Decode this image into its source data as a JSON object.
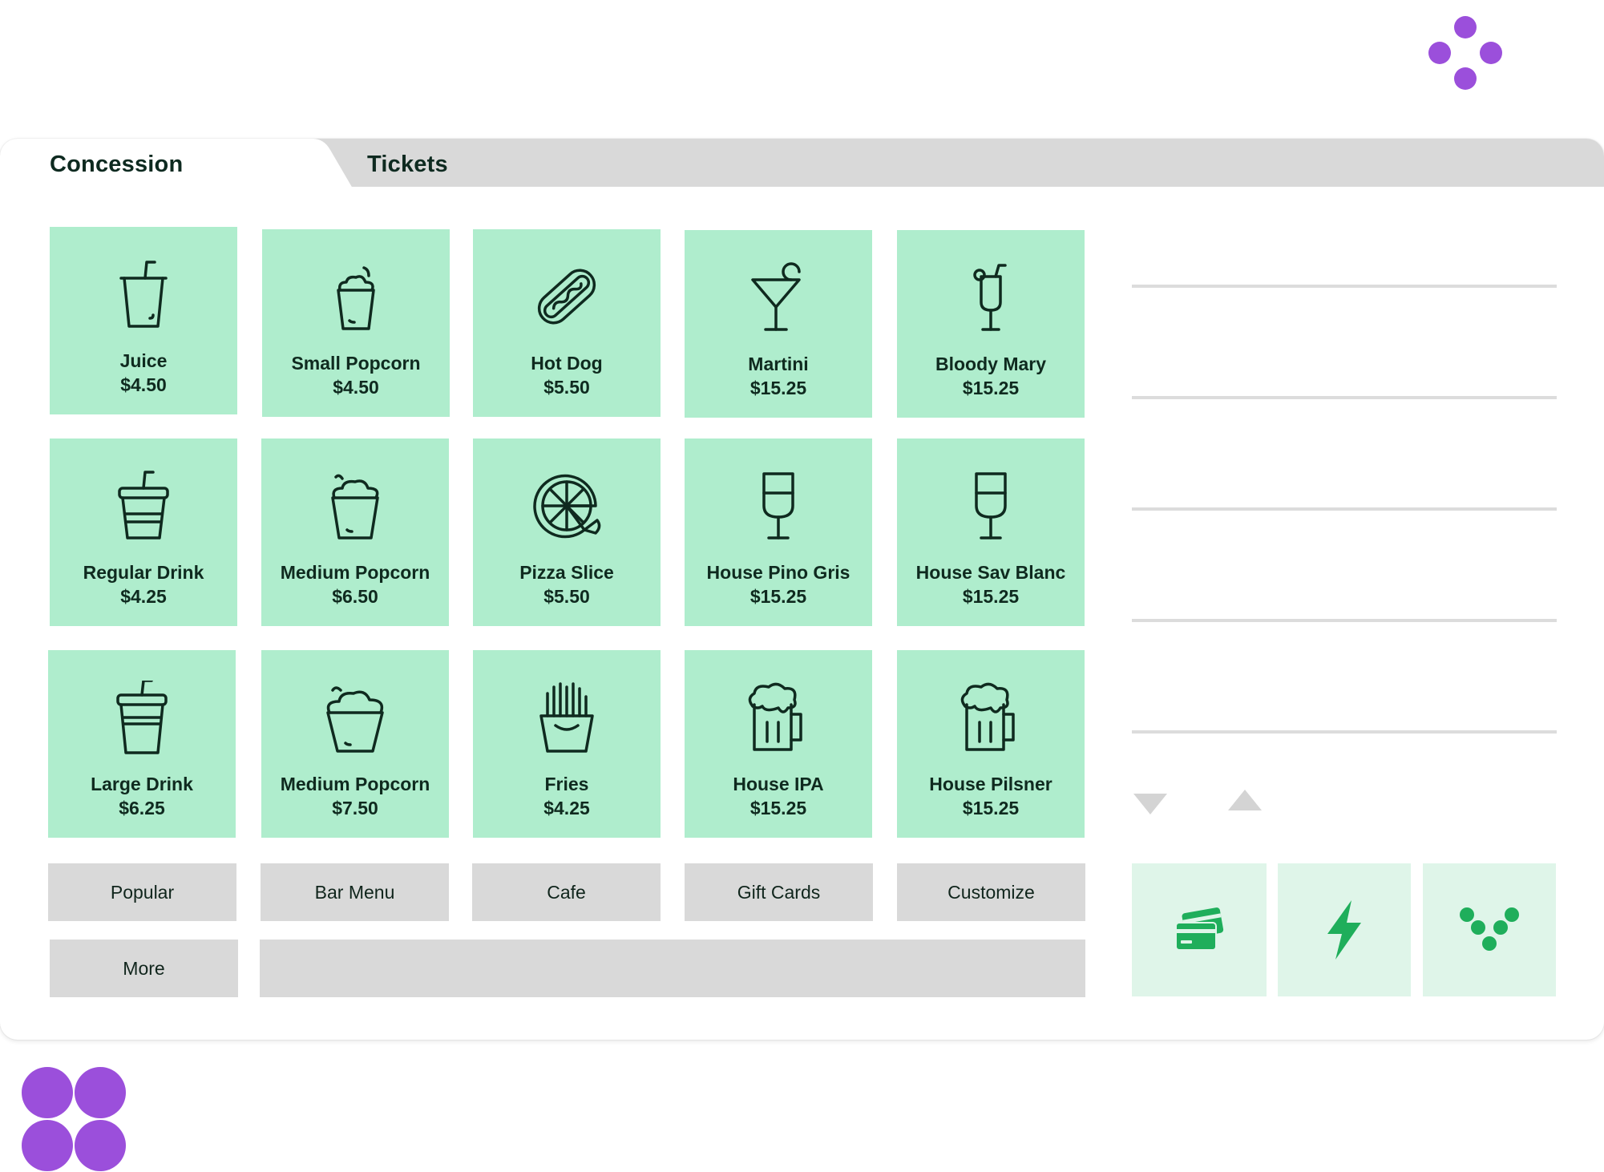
{
  "tabs": {
    "concession": "Concession",
    "tickets": "Tickets"
  },
  "colors": {
    "tile": "#afedcd",
    "category_button": "#d9d9d9",
    "pay_button": "#dff5e9",
    "pay_icon": "#1fae5b",
    "decor_purple": "#9b4fdb",
    "divider": "#dcdcdc",
    "control_icon": "#d4d4d4"
  },
  "items": [
    {
      "name": "Juice",
      "price": "$4.50",
      "icon": "cup-with-straw-icon"
    },
    {
      "name": "Small Popcorn",
      "price": "$4.50",
      "icon": "popcorn-icon"
    },
    {
      "name": "Hot Dog",
      "price": "$5.50",
      "icon": "hot-dog-icon"
    },
    {
      "name": "Martini",
      "price": "$15.25",
      "icon": "martini-glass-icon"
    },
    {
      "name": "Bloody Mary",
      "price": "$15.25",
      "icon": "cocktail-glass-icon"
    },
    {
      "name": "Regular Drink",
      "price": "$4.25",
      "icon": "soda-cup-icon"
    },
    {
      "name": "Medium Popcorn",
      "price": "$6.50",
      "icon": "popcorn-icon"
    },
    {
      "name": "Pizza Slice",
      "price": "$5.50",
      "icon": "pizza-icon"
    },
    {
      "name": "House Pino Gris",
      "price": "$15.25",
      "icon": "wine-glass-icon"
    },
    {
      "name": "House Sav Blanc",
      "price": "$15.25",
      "icon": "wine-glass-icon"
    },
    {
      "name": "Large Drink",
      "price": "$6.25",
      "icon": "soda-cup-icon"
    },
    {
      "name": "Medium Popcorn",
      "price": "$7.50",
      "icon": "popcorn-icon"
    },
    {
      "name": "Fries",
      "price": "$4.25",
      "icon": "fries-icon"
    },
    {
      "name": "House IPA",
      "price": "$15.25",
      "icon": "beer-mug-icon"
    },
    {
      "name": "House Pilsner",
      "price": "$15.25",
      "icon": "beer-mug-icon"
    }
  ],
  "categories": [
    "Popular",
    "Bar Menu",
    "Cafe",
    "Gift Cards",
    "Customize",
    "More"
  ],
  "controls": [
    "arrow-down-icon",
    "arrow-up-icon",
    "refresh-icon",
    "hand-icon",
    "cancel-icon"
  ],
  "payment_buttons": [
    "credit-cards-icon",
    "lightning-bolt-icon",
    "dots-logo-icon"
  ]
}
